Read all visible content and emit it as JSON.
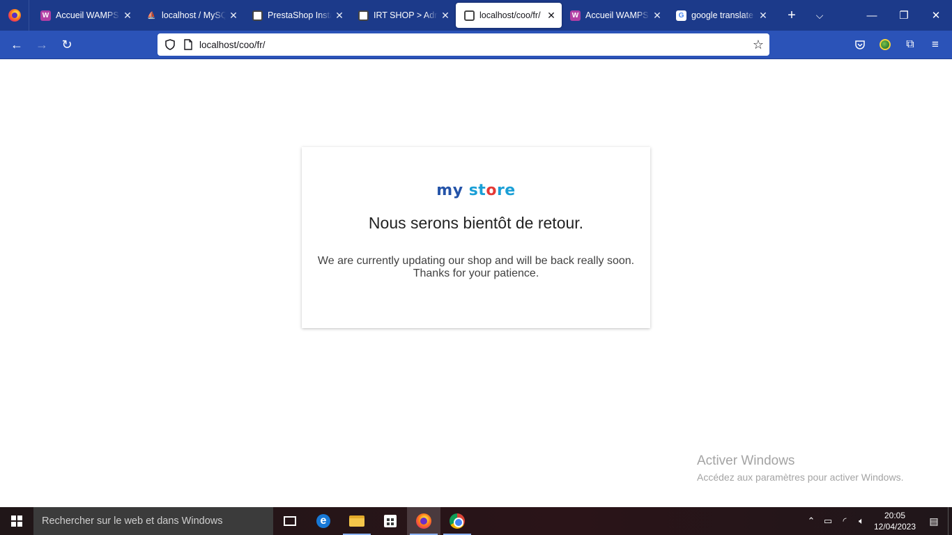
{
  "browser": {
    "tabs": [
      {
        "label": "Accueil WAMPSERVER",
        "favicon": "wamp-icon",
        "active": false
      },
      {
        "label": "localhost / MySQL",
        "favicon": "phpmyadmin-icon",
        "active": false
      },
      {
        "label": "PrestaShop Installation",
        "favicon": "prestashop-icon",
        "active": false
      },
      {
        "label": "IRT SHOP > Administration",
        "favicon": "prestashop-icon",
        "active": false
      },
      {
        "label": "localhost/coo/fr/",
        "favicon": "prestashop-icon",
        "active": true
      },
      {
        "label": "Accueil WAMPSERVER",
        "favicon": "wamp-icon",
        "active": false
      },
      {
        "label": "google translate - Recherche",
        "favicon": "google-icon",
        "active": false
      }
    ],
    "url": "localhost/coo/fr/"
  },
  "page": {
    "logo": {
      "part1": "my",
      "part2": "st",
      "part3": "o",
      "part4": "re"
    },
    "title": "Nous serons bientôt de retour.",
    "message_line1": "We are currently updating our shop and will be back really soon.",
    "message_line2": "Thanks for your patience."
  },
  "watermark": {
    "title": "Activer Windows",
    "subtitle": "Accédez aux paramètres pour activer Windows."
  },
  "taskbar": {
    "search_placeholder": "Rechercher sur le web et dans Windows",
    "time": "20:05",
    "date": "12/04/2023"
  },
  "colors": {
    "tabstrip": "#1c3a8a",
    "navbar": "#2b53b8",
    "logo_blue": "#2453a8",
    "logo_cyan": "#1a9fd6",
    "logo_red": "#e53935"
  }
}
